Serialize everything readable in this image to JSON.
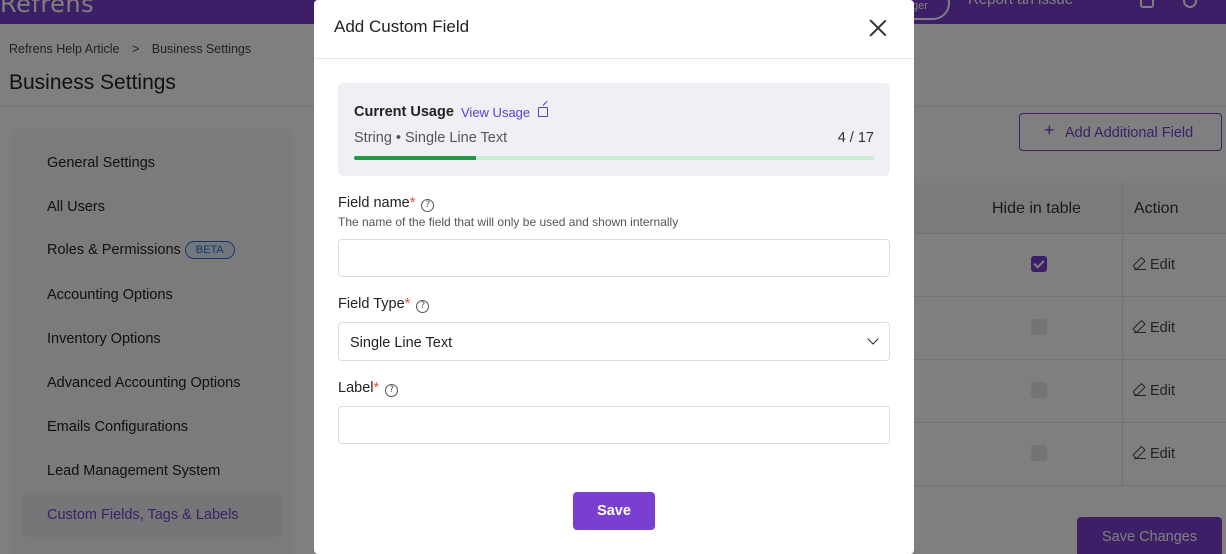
{
  "app": {
    "logo": "Refrens",
    "topbar_pill": "ger",
    "report_issue": "Report an issue"
  },
  "breadcrumb": {
    "items": [
      "Refrens Help Article",
      "Business Settings"
    ],
    "separator": ">"
  },
  "page_title": "Business Settings",
  "sidebar": {
    "items": [
      {
        "label": "General Settings"
      },
      {
        "label": "All Users"
      },
      {
        "label": "Roles & Permissions",
        "badge": "BETA"
      },
      {
        "label": "Accounting Options"
      },
      {
        "label": "Inventory Options"
      },
      {
        "label": "Advanced Accounting Options"
      },
      {
        "label": "Emails Configurations"
      },
      {
        "label": "Lead Management System"
      },
      {
        "label": "Custom Fields, Tags & Labels",
        "active": true
      }
    ]
  },
  "main": {
    "add_field_label": "Add Additional Field",
    "add_field_icon": "+",
    "table": {
      "headers": [
        "Hide in table",
        "Action"
      ],
      "rows": [
        {
          "hide_in_table": true,
          "action": "Edit"
        },
        {
          "hide_in_table": false,
          "action": "Edit"
        },
        {
          "hide_in_table": false,
          "action": "Edit"
        },
        {
          "hide_in_table": false,
          "action": "Edit"
        }
      ]
    },
    "save_changes_label": "Save Changes"
  },
  "modal": {
    "title": "Add Custom Field",
    "close_icon": "close-icon",
    "usage": {
      "title": "Current Usage",
      "view_usage_label": "View Usage",
      "type_text": "String • Single Line Text",
      "count_text": "4 / 17",
      "used": 4,
      "total": 17
    },
    "field_name": {
      "label": "Field name",
      "required_mark": "*",
      "help": "The name of the field that will only be used and shown internally",
      "value": "",
      "placeholder": ""
    },
    "field_type": {
      "label": "Field Type",
      "required_mark": "*",
      "selected": "Single Line Text"
    },
    "label_field": {
      "label": "Label",
      "required_mark": "*",
      "value": "",
      "placeholder": ""
    },
    "help_icon_glyph": "?",
    "save_label": "Save"
  },
  "colors": {
    "brand": "#7a3fd1",
    "usage_fill": "#1f9b47",
    "usage_track": "#c9ecd4",
    "required": "#d9534f",
    "link": "#5a3fd1"
  }
}
